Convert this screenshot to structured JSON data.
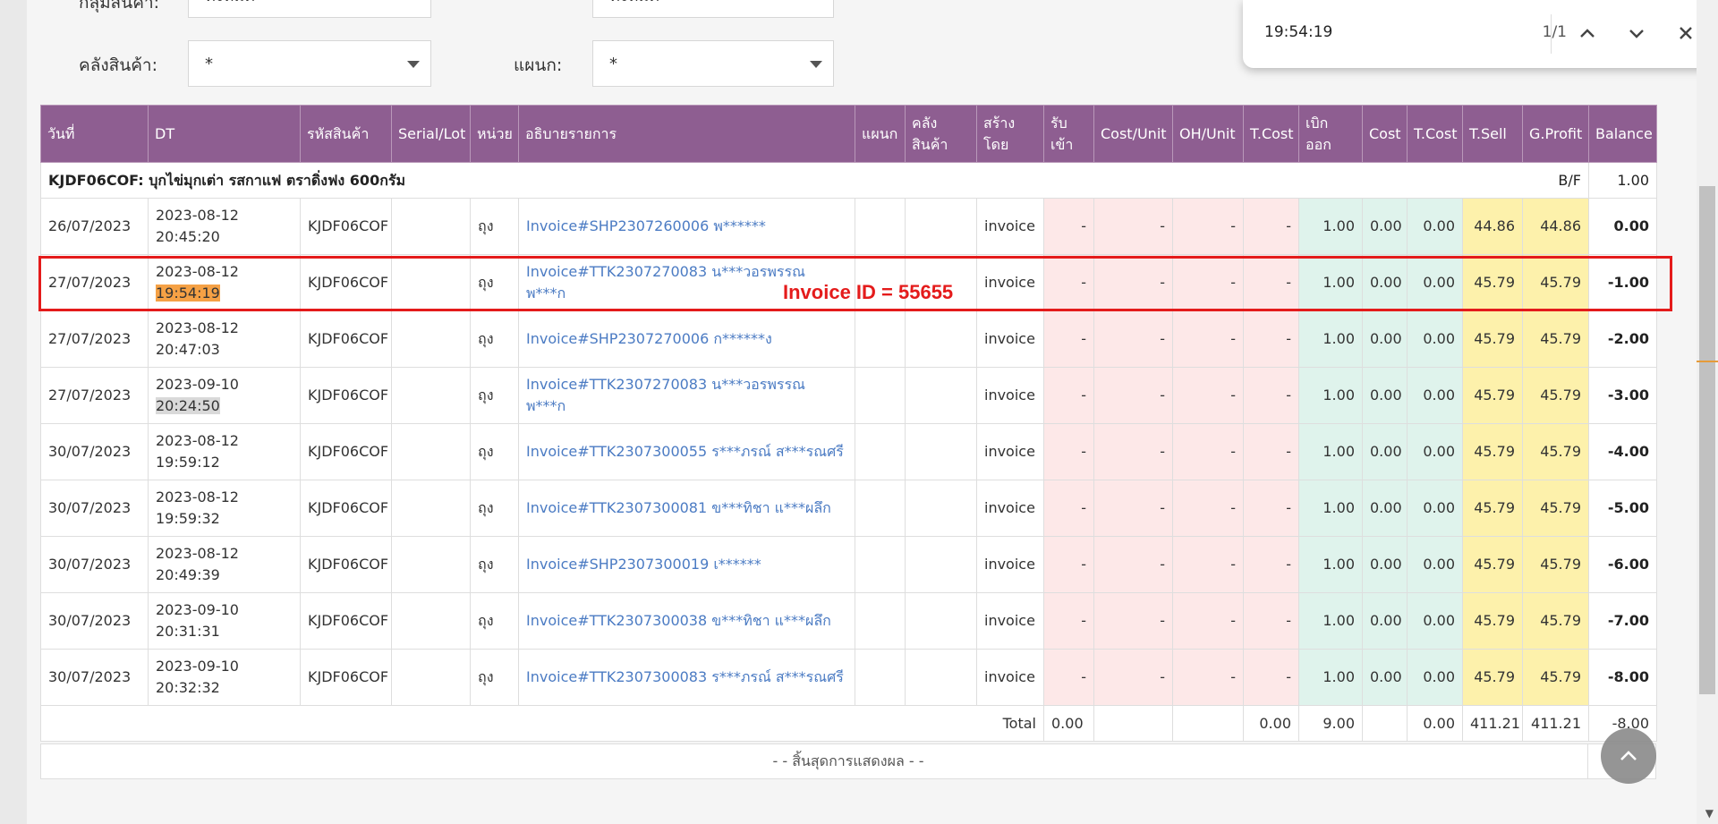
{
  "filters": {
    "top_left_label": "กลุ่มสินค้า:",
    "top_left_value": "ทั้งหมด",
    "top_right_value": "ทั้งหมด",
    "warehouse_label": "คลังสินค้า:",
    "warehouse_value": "*",
    "department_label": "แผนก:",
    "department_value": "*"
  },
  "find": {
    "query": "19:54:19",
    "count": "1/1"
  },
  "table": {
    "headers": [
      "วันที่",
      "DT",
      "รหัสสินค้า",
      "Serial/Lot",
      "หน่วย",
      "อธิบายรายการ",
      "แผนก",
      "คลัง\nสินค้า",
      "สร้าง\nโดย",
      "รับ\nเข้า",
      "Cost/Unit",
      "OH/Unit",
      "T.Cost",
      "เบิก\nออก",
      "Cost",
      "T.Cost",
      "T.Sell",
      "G.Profit",
      "Balance"
    ],
    "bf": {
      "title": "KJDF06COF: บุกไข่มุกเต่า รสกาแฟ ตราดิ่งฟง 600กรัม",
      "label": "B/F",
      "value": "1.00"
    },
    "rows": [
      {
        "date": "26/07/2023",
        "dt1": "2023-08-12",
        "dt2": "20:45:20",
        "code": "KJDF06COF",
        "serial": "",
        "unit": "ถุง",
        "desc": "Invoice#SHP2307260006 พ******",
        "dept": "",
        "wh": "",
        "by": "invoice",
        "in": "-",
        "cu": "-",
        "oh": "-",
        "tc": "-",
        "out": "1.00",
        "cost": "0.00",
        "tcost": "0.00",
        "tsell": "44.86",
        "gp": "44.86",
        "bal": "0.00"
      },
      {
        "date": "27/07/2023",
        "dt1": "2023-08-12",
        "dt2": "19:54:19",
        "code": "KJDF06COF",
        "serial": "",
        "unit": "ถุง",
        "desc": "Invoice#TTK2307270083 น***วอรพรรณ พ***ก",
        "dept": "",
        "wh": "",
        "by": "invoice",
        "in": "-",
        "cu": "-",
        "oh": "-",
        "tc": "-",
        "out": "1.00",
        "cost": "0.00",
        "tcost": "0.00",
        "tsell": "45.79",
        "gp": "45.79",
        "bal": "-1.00"
      },
      {
        "date": "27/07/2023",
        "dt1": "2023-08-12",
        "dt2": "20:47:03",
        "code": "KJDF06COF",
        "serial": "",
        "unit": "ถุง",
        "desc": "Invoice#SHP2307270006 ก******ง",
        "dept": "",
        "wh": "",
        "by": "invoice",
        "in": "-",
        "cu": "-",
        "oh": "-",
        "tc": "-",
        "out": "1.00",
        "cost": "0.00",
        "tcost": "0.00",
        "tsell": "45.79",
        "gp": "45.79",
        "bal": "-2.00"
      },
      {
        "date": "27/07/2023",
        "dt1": "2023-09-10",
        "dt2": "20:24:50",
        "code": "KJDF06COF",
        "serial": "",
        "unit": "ถุง",
        "desc": "Invoice#TTK2307270083 น***วอรพรรณ พ***ก",
        "dept": "",
        "wh": "",
        "by": "invoice",
        "in": "-",
        "cu": "-",
        "oh": "-",
        "tc": "-",
        "out": "1.00",
        "cost": "0.00",
        "tcost": "0.00",
        "tsell": "45.79",
        "gp": "45.79",
        "bal": "-3.00"
      },
      {
        "date": "30/07/2023",
        "dt1": "2023-08-12",
        "dt2": "19:59:12",
        "code": "KJDF06COF",
        "serial": "",
        "unit": "ถุง",
        "desc": "Invoice#TTK2307300055 ร***ภรณ์ ส***รณศรี",
        "dept": "",
        "wh": "",
        "by": "invoice",
        "in": "-",
        "cu": "-",
        "oh": "-",
        "tc": "-",
        "out": "1.00",
        "cost": "0.00",
        "tcost": "0.00",
        "tsell": "45.79",
        "gp": "45.79",
        "bal": "-4.00"
      },
      {
        "date": "30/07/2023",
        "dt1": "2023-08-12",
        "dt2": "19:59:32",
        "code": "KJDF06COF",
        "serial": "",
        "unit": "ถุง",
        "desc": "Invoice#TTK2307300081 ข***ทิชา แ***ผลึก",
        "dept": "",
        "wh": "",
        "by": "invoice",
        "in": "-",
        "cu": "-",
        "oh": "-",
        "tc": "-",
        "out": "1.00",
        "cost": "0.00",
        "tcost": "0.00",
        "tsell": "45.79",
        "gp": "45.79",
        "bal": "-5.00"
      },
      {
        "date": "30/07/2023",
        "dt1": "2023-08-12",
        "dt2": "20:49:39",
        "code": "KJDF06COF",
        "serial": "",
        "unit": "ถุง",
        "desc": "Invoice#SHP2307300019 เ******",
        "dept": "",
        "wh": "",
        "by": "invoice",
        "in": "-",
        "cu": "-",
        "oh": "-",
        "tc": "-",
        "out": "1.00",
        "cost": "0.00",
        "tcost": "0.00",
        "tsell": "45.79",
        "gp": "45.79",
        "bal": "-6.00"
      },
      {
        "date": "30/07/2023",
        "dt1": "2023-09-10",
        "dt2": "20:31:31",
        "code": "KJDF06COF",
        "serial": "",
        "unit": "ถุง",
        "desc": "Invoice#TTK2307300038 ข***ทิชา แ***ผลึก",
        "dept": "",
        "wh": "",
        "by": "invoice",
        "in": "-",
        "cu": "-",
        "oh": "-",
        "tc": "-",
        "out": "1.00",
        "cost": "0.00",
        "tcost": "0.00",
        "tsell": "45.79",
        "gp": "45.79",
        "bal": "-7.00"
      },
      {
        "date": "30/07/2023",
        "dt1": "2023-09-10",
        "dt2": "20:32:32",
        "code": "KJDF06COF",
        "serial": "",
        "unit": "ถุง",
        "desc": "Invoice#TTK2307300083 ร***ภรณ์ ส***รณศรี",
        "dept": "",
        "wh": "",
        "by": "invoice",
        "in": "-",
        "cu": "-",
        "oh": "-",
        "tc": "-",
        "out": "1.00",
        "cost": "0.00",
        "tcost": "0.00",
        "tsell": "45.79",
        "gp": "45.79",
        "bal": "-8.00"
      }
    ],
    "total": {
      "label": "Total",
      "in": "0.00",
      "tc": "0.00",
      "out": "9.00",
      "tcost": "0.00",
      "tsell": "411.21",
      "gp": "411.21",
      "bal": "-8.00"
    },
    "end_text": "- - สิ้นสุดการแสดงผล - -"
  },
  "annotation": "Invoice ID = 55655",
  "colors": {
    "header": "#8e5e91",
    "annotation": "#e41b1b",
    "link": "#4b7bc3",
    "find_highlight": "#f5a145"
  }
}
